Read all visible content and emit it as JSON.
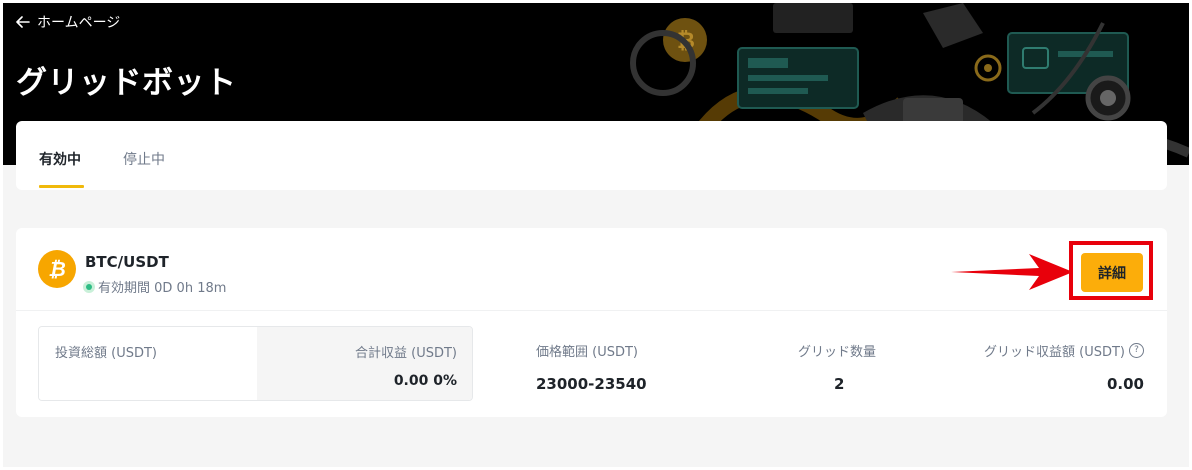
{
  "header": {
    "back_label": "ホームページ",
    "title": "グリッドボット"
  },
  "tabs": [
    {
      "label": "有効中",
      "active": true
    },
    {
      "label": "停止中",
      "active": false
    }
  ],
  "bot": {
    "pair": "BTC/USDT",
    "coin_symbol": "₿",
    "status": "有効期間 0D 0h 18m",
    "detail_button": "詳細",
    "investment_label": "投資総額 (USDT)",
    "investment_value": "",
    "total_profit_label": "合計収益 (USDT)",
    "total_profit_value": "0.00 0%",
    "price_range_label": "価格範囲 (USDT)",
    "price_range_value": "23000-23540",
    "grid_count_label": "グリッド数量",
    "grid_count_value": "2",
    "grid_profit_label": "グリッド収益額 (USDT)",
    "grid_profit_value": "0.00"
  },
  "colors": {
    "accent": "#f0b90b",
    "button": "#fcad0a",
    "highlight": "#e8000b",
    "active_status": "#2ebd85",
    "coin": "#f7a600"
  },
  "icons": {
    "back": "arrow-left-icon",
    "help": "question-circle-icon",
    "annotation": "red-arrow-icon"
  }
}
